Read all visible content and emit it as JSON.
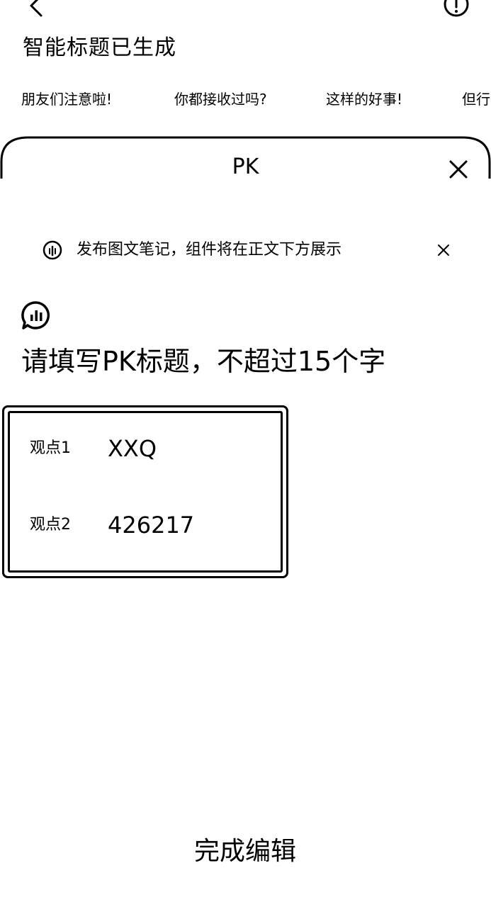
{
  "header": {
    "back_icon": "chevron-left-icon",
    "info_icon": "info-circle-icon",
    "heading": "智能标题已生成"
  },
  "title_suggestions": [
    "朋友们注意啦!",
    "你都接收过吗?",
    "这样的好事!",
    "但行"
  ],
  "pk_sheet": {
    "title": "PK",
    "close_icon": "close-icon",
    "notice": {
      "icon": "info-circle-icon",
      "text": "发布图文笔记，组件将在正文下方展示",
      "close_icon": "close-icon"
    },
    "pk_icon": "chat-bubble-chart-icon",
    "title_placeholder": "请填写PK标题，不超过15个字",
    "title_value": "",
    "options": [
      {
        "label": "观点1",
        "value": "XXQ"
      },
      {
        "label": "观点2",
        "value": "426217"
      }
    ],
    "done_label": "完成编辑"
  }
}
